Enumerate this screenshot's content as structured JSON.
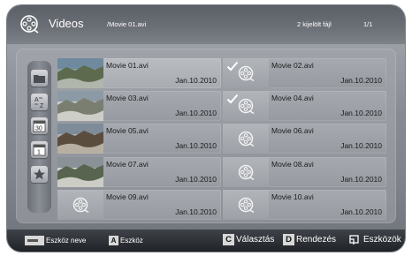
{
  "header": {
    "app_title": "Videos",
    "current_path": "/Movie 01.avi",
    "selected_count": "2 kijelölt fájl",
    "page_indicator": "1/1"
  },
  "sidebar": {
    "items": [
      {
        "icon": "folder-icon"
      },
      {
        "icon": "sort-az-icon"
      },
      {
        "icon": "calendar-icon"
      },
      {
        "icon": "calendar-month-icon"
      },
      {
        "icon": "star-icon"
      }
    ]
  },
  "files": [
    {
      "name": "Movie 01.avi",
      "date": "Jan.10.2010",
      "thumbnail": "landscape-photo",
      "selected": false,
      "focused": true
    },
    {
      "name": "Movie 02.avi",
      "date": "Jan.10.2010",
      "thumbnail": "film-icon",
      "selected": true,
      "focused": false
    },
    {
      "name": "Movie 03.avi",
      "date": "Jan.10.2010",
      "thumbnail": "landscape-photo",
      "selected": false,
      "focused": false
    },
    {
      "name": "Movie 04.avi",
      "date": "Jan.10.2010",
      "thumbnail": "film-icon",
      "selected": true,
      "focused": false
    },
    {
      "name": "Movie 05.avi",
      "date": "Jan.10.2010",
      "thumbnail": "landscape-photo",
      "selected": false,
      "focused": false
    },
    {
      "name": "Movie 06.avi",
      "date": "Jan.10.2010",
      "thumbnail": "film-icon",
      "selected": false,
      "focused": false
    },
    {
      "name": "Movie 07.avi",
      "date": "Jan.10.2010",
      "thumbnail": "landscape-photo",
      "selected": false,
      "focused": false
    },
    {
      "name": "Movie 08.avi",
      "date": "Jan.10.2010",
      "thumbnail": "film-icon",
      "selected": false,
      "focused": false
    },
    {
      "name": "Movie 09.avi",
      "date": "Jan.10.2010",
      "thumbnail": "film-icon",
      "selected": false,
      "focused": false
    },
    {
      "name": "Movie 10.avi",
      "date": "Jan.10.2010",
      "thumbnail": "film-icon",
      "selected": false,
      "focused": false
    }
  ],
  "footer": {
    "device_name_label": "Eszköz neve",
    "a_key": "A",
    "a_label": "Eszköz",
    "c_key": "C",
    "c_label": "Választás",
    "d_key": "D",
    "d_label": "Rendezés",
    "tools_label": "Eszközök"
  },
  "colors": {
    "header_text": "#ffffff",
    "check_mark": "#ffffff",
    "footer_bg": "#2a2d31"
  }
}
